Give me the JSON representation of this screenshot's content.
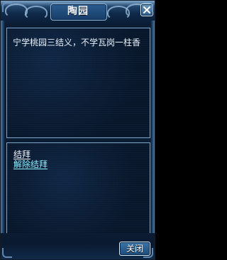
{
  "window": {
    "title": "陶园",
    "close_icon": "close-icon",
    "close_button_label": "关闭"
  },
  "dialog": {
    "message": "宁学桃园三结义，不学瓦岗一柱香"
  },
  "options": [
    {
      "label": "结拜"
    },
    {
      "label": "解除结拜"
    }
  ],
  "colors": {
    "panel_border": "#7ba3c7",
    "link": "#8ff0ff",
    "text": "#e9f3ff"
  }
}
